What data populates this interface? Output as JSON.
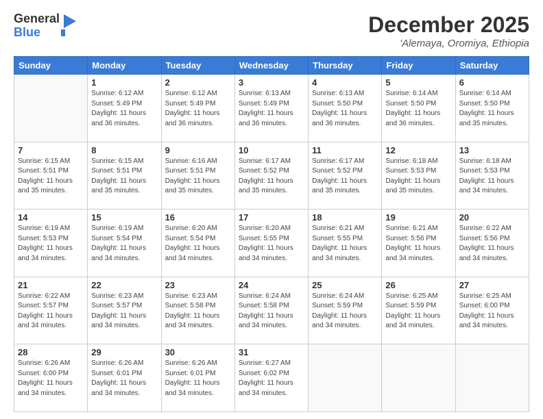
{
  "logo": {
    "general": "General",
    "blue": "Blue"
  },
  "header": {
    "month": "December 2025",
    "location": "'Alemaya, Oromiya, Ethiopia"
  },
  "weekdays": [
    "Sunday",
    "Monday",
    "Tuesday",
    "Wednesday",
    "Thursday",
    "Friday",
    "Saturday"
  ],
  "weeks": [
    [
      {
        "day": "",
        "info": ""
      },
      {
        "day": "1",
        "info": "Sunrise: 6:12 AM\nSunset: 5:49 PM\nDaylight: 11 hours\nand 36 minutes."
      },
      {
        "day": "2",
        "info": "Sunrise: 6:12 AM\nSunset: 5:49 PM\nDaylight: 11 hours\nand 36 minutes."
      },
      {
        "day": "3",
        "info": "Sunrise: 6:13 AM\nSunset: 5:49 PM\nDaylight: 11 hours\nand 36 minutes."
      },
      {
        "day": "4",
        "info": "Sunrise: 6:13 AM\nSunset: 5:50 PM\nDaylight: 11 hours\nand 36 minutes."
      },
      {
        "day": "5",
        "info": "Sunrise: 6:14 AM\nSunset: 5:50 PM\nDaylight: 11 hours\nand 36 minutes."
      },
      {
        "day": "6",
        "info": "Sunrise: 6:14 AM\nSunset: 5:50 PM\nDaylight: 11 hours\nand 35 minutes."
      }
    ],
    [
      {
        "day": "7",
        "info": "Sunrise: 6:15 AM\nSunset: 5:51 PM\nDaylight: 11 hours\nand 35 minutes."
      },
      {
        "day": "8",
        "info": "Sunrise: 6:15 AM\nSunset: 5:51 PM\nDaylight: 11 hours\nand 35 minutes."
      },
      {
        "day": "9",
        "info": "Sunrise: 6:16 AM\nSunset: 5:51 PM\nDaylight: 11 hours\nand 35 minutes."
      },
      {
        "day": "10",
        "info": "Sunrise: 6:17 AM\nSunset: 5:52 PM\nDaylight: 11 hours\nand 35 minutes."
      },
      {
        "day": "11",
        "info": "Sunrise: 6:17 AM\nSunset: 5:52 PM\nDaylight: 11 hours\nand 35 minutes."
      },
      {
        "day": "12",
        "info": "Sunrise: 6:18 AM\nSunset: 5:53 PM\nDaylight: 11 hours\nand 35 minutes."
      },
      {
        "day": "13",
        "info": "Sunrise: 6:18 AM\nSunset: 5:53 PM\nDaylight: 11 hours\nand 34 minutes."
      }
    ],
    [
      {
        "day": "14",
        "info": "Sunrise: 6:19 AM\nSunset: 5:53 PM\nDaylight: 11 hours\nand 34 minutes."
      },
      {
        "day": "15",
        "info": "Sunrise: 6:19 AM\nSunset: 5:54 PM\nDaylight: 11 hours\nand 34 minutes."
      },
      {
        "day": "16",
        "info": "Sunrise: 6:20 AM\nSunset: 5:54 PM\nDaylight: 11 hours\nand 34 minutes."
      },
      {
        "day": "17",
        "info": "Sunrise: 6:20 AM\nSunset: 5:55 PM\nDaylight: 11 hours\nand 34 minutes."
      },
      {
        "day": "18",
        "info": "Sunrise: 6:21 AM\nSunset: 5:55 PM\nDaylight: 11 hours\nand 34 minutes."
      },
      {
        "day": "19",
        "info": "Sunrise: 6:21 AM\nSunset: 5:56 PM\nDaylight: 11 hours\nand 34 minutes."
      },
      {
        "day": "20",
        "info": "Sunrise: 6:22 AM\nSunset: 5:56 PM\nDaylight: 11 hours\nand 34 minutes."
      }
    ],
    [
      {
        "day": "21",
        "info": "Sunrise: 6:22 AM\nSunset: 5:57 PM\nDaylight: 11 hours\nand 34 minutes."
      },
      {
        "day": "22",
        "info": "Sunrise: 6:23 AM\nSunset: 5:57 PM\nDaylight: 11 hours\nand 34 minutes."
      },
      {
        "day": "23",
        "info": "Sunrise: 6:23 AM\nSunset: 5:58 PM\nDaylight: 11 hours\nand 34 minutes."
      },
      {
        "day": "24",
        "info": "Sunrise: 6:24 AM\nSunset: 5:58 PM\nDaylight: 11 hours\nand 34 minutes."
      },
      {
        "day": "25",
        "info": "Sunrise: 6:24 AM\nSunset: 5:59 PM\nDaylight: 11 hours\nand 34 minutes."
      },
      {
        "day": "26",
        "info": "Sunrise: 6:25 AM\nSunset: 5:59 PM\nDaylight: 11 hours\nand 34 minutes."
      },
      {
        "day": "27",
        "info": "Sunrise: 6:25 AM\nSunset: 6:00 PM\nDaylight: 11 hours\nand 34 minutes."
      }
    ],
    [
      {
        "day": "28",
        "info": "Sunrise: 6:26 AM\nSunset: 6:00 PM\nDaylight: 11 hours\nand 34 minutes."
      },
      {
        "day": "29",
        "info": "Sunrise: 6:26 AM\nSunset: 6:01 PM\nDaylight: 11 hours\nand 34 minutes."
      },
      {
        "day": "30",
        "info": "Sunrise: 6:26 AM\nSunset: 6:01 PM\nDaylight: 11 hours\nand 34 minutes."
      },
      {
        "day": "31",
        "info": "Sunrise: 6:27 AM\nSunset: 6:02 PM\nDaylight: 11 hours\nand 34 minutes."
      },
      {
        "day": "",
        "info": ""
      },
      {
        "day": "",
        "info": ""
      },
      {
        "day": "",
        "info": ""
      }
    ]
  ]
}
